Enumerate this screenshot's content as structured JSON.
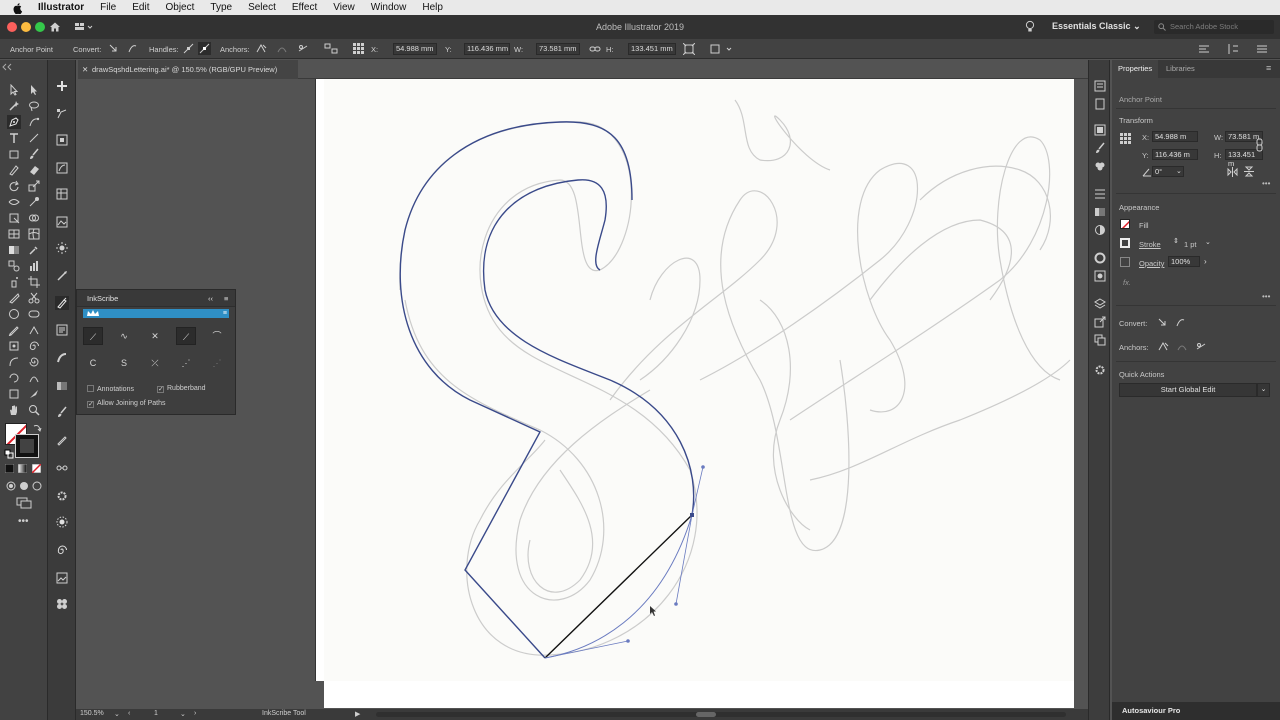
{
  "menubar": {
    "app_name": "Illustrator",
    "items": [
      "File",
      "Edit",
      "Object",
      "Type",
      "Select",
      "Effect",
      "View",
      "Window",
      "Help"
    ]
  },
  "titlebar": {
    "title": "Adobe Illustrator 2019",
    "workspace": "Essentials Classic",
    "search_placeholder": "Search Adobe Stock"
  },
  "controlbar": {
    "selection_label": "Anchor Point",
    "convert_label": "Convert:",
    "handles_label": "Handles:",
    "anchors_label": "Anchors:",
    "x_label": "X:",
    "x_value": "54.988 mm",
    "y_label": "Y:",
    "y_value": "116.436 mm",
    "w_label": "W:",
    "w_value": "73.581 mm",
    "h_label": "H:",
    "h_value": "133.451 mm"
  },
  "document": {
    "tab_title": "drawSqshdLettering.ai* @ 150.5% (RGB/GPU Preview)"
  },
  "inkscribe": {
    "title": "InkScribe",
    "row1": [
      "⟋",
      "∿",
      "✕",
      "⟋",
      "⌒"
    ],
    "row2": [
      "C",
      "S",
      "⤫",
      "⋰",
      "⋰"
    ],
    "annotations_label": "Annotations",
    "rubberband_label": "Rubberband",
    "allow_join_label": "Allow Joining of Paths",
    "checkmark": "✓"
  },
  "properties": {
    "tabs": [
      "Properties",
      "Libraries"
    ],
    "selection_type": "Anchor Point",
    "transform_title": "Transform",
    "x_label": "X:",
    "x_value": "54.988 m",
    "y_label": "Y:",
    "y_value": "116.436 m",
    "w_label": "W:",
    "w_value": "73.581 m",
    "h_label": "H:",
    "h_value": "133.451 m",
    "angle_value": "0°",
    "appearance_title": "Appearance",
    "fill_label": "Fill",
    "stroke_label": "Stroke",
    "stroke_value": "1 pt",
    "opacity_label": "Opacity",
    "opacity_value": "100%",
    "fx_label": "fx.",
    "convert_label": "Convert:",
    "anchors_label": "Anchors:",
    "quick_actions_title": "Quick Actions",
    "global_edit_label": "Start Global Edit",
    "footer_label": "Autosaviour Pro"
  },
  "statusbar": {
    "zoom": "150.5%",
    "artboard": "1",
    "tool": "InkScribe Tool"
  },
  "colors": {
    "accent": "#2f8fc5",
    "path": "#3a4a8a",
    "menubar_bg": "#e9e9e9",
    "panel_bg": "#424242"
  }
}
